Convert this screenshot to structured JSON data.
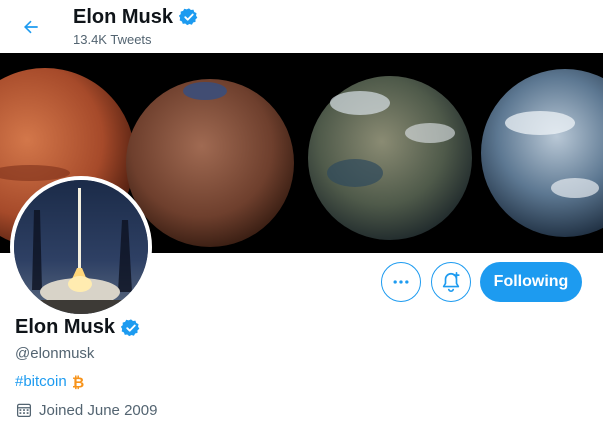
{
  "header": {
    "name": "Elon Musk",
    "tweet_count": "13.4K Tweets"
  },
  "profile": {
    "name": "Elon Musk",
    "handle": "@elonmusk",
    "bio_hashtag": "#bitcoin",
    "bio_emoji": "bitcoin-icon",
    "joined": "Joined June 2009"
  },
  "actions": {
    "follow_label": "Following",
    "more_icon": "more-icon",
    "notify_icon": "bell-plus-icon"
  },
  "colors": {
    "accent": "#1d9bf0",
    "text_primary": "#0f1419",
    "text_secondary": "#536471",
    "bitcoin": "#f7931a"
  }
}
